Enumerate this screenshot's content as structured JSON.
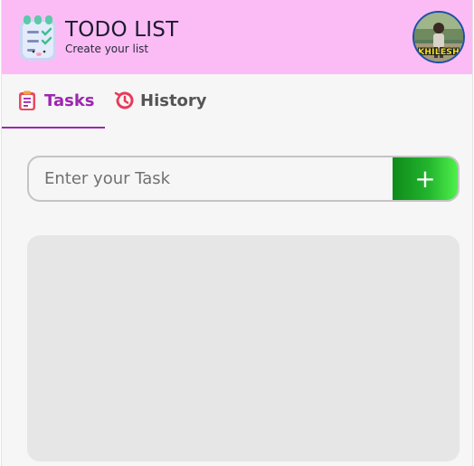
{
  "header": {
    "title": "TODO LIST",
    "subtitle": "Create your list",
    "bg_color": "#fbbcf6",
    "logo_icon": "clipboard-checklist-icon",
    "avatar_label": "KHILESH"
  },
  "tabs": [
    {
      "label": "Tasks",
      "icon": "clipboard-icon",
      "active": true,
      "color": "#9c27b0"
    },
    {
      "label": "History",
      "icon": "history-clock-icon",
      "active": false,
      "color": "#555555"
    }
  ],
  "task_input": {
    "placeholder": "Enter your Task",
    "value": ""
  },
  "add_button": {
    "label": "+",
    "icon": "plus-icon"
  },
  "task_list": {
    "items": []
  }
}
